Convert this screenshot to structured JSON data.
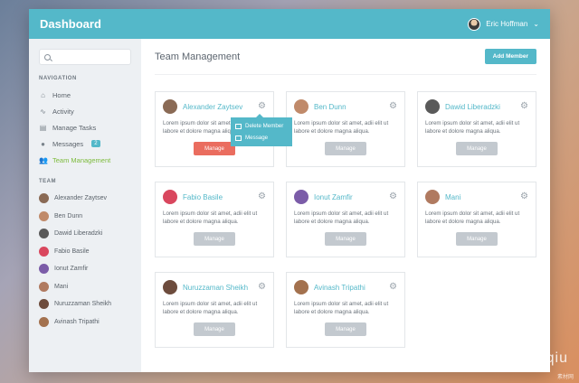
{
  "header": {
    "title": "Dashboard",
    "user_name": "Eric Hoffman"
  },
  "sidebar": {
    "search_placeholder": "",
    "navigation_heading": "NAVIGATION",
    "nav": [
      {
        "label": "Home",
        "icon": "home-icon"
      },
      {
        "label": "Activity",
        "icon": "activity-icon"
      },
      {
        "label": "Manage Tasks",
        "icon": "tasks-icon"
      },
      {
        "label": "Messages",
        "icon": "messages-icon",
        "badge": "2"
      },
      {
        "label": "Team Management",
        "icon": "team-icon",
        "active": true
      }
    ],
    "team_heading": "TEAM",
    "team": [
      "Alexander Zaytsev",
      "Ben Dunn",
      "Dawid Liberadzki",
      "Fabio Basile",
      "Ionut Zamfir",
      "Mani",
      "Nuruzzaman Sheikh",
      "Avinash Tripathi"
    ]
  },
  "main": {
    "title": "Team Management",
    "add_button": "Add Member",
    "cards": [
      {
        "name": "Alexander Zaytsev",
        "text": "Lorem ipsum dolor sit amet, adii elit ut labore et dolore magna aliqua.",
        "button": "Manage"
      },
      {
        "name": "Ben Dunn",
        "text": "Lorem ipsum dolor sit amet, adii elit ut labore et dolore magna aliqua.",
        "button": "Manage"
      },
      {
        "name": "Dawid Liberadzki",
        "text": "Lorem ipsum dolor sit amet, adii elit ut labore et dolore magna aliqua.",
        "button": "Manage"
      },
      {
        "name": "Fabio Basile",
        "text": "Lorem ipsum dolor sit amet, adii elit ut labore et dolore magna aliqua.",
        "button": "Manage"
      },
      {
        "name": "Ionut Zamfir",
        "text": "Lorem ipsum dolor sit amet, adii elit ut labore et dolore magna aliqua.",
        "button": "Manage"
      },
      {
        "name": "Mani",
        "text": "Lorem ipsum dolor sit amet, adii elit ut labore et dolore magna aliqua.",
        "button": "Manage"
      },
      {
        "name": "Nuruzzaman Sheikh",
        "text": "Lorem ipsum dolor sit amet, adii elit ut labore et dolore magna aliqua.",
        "button": "Manage"
      },
      {
        "name": "Avinash Tripathi",
        "text": "Lorem ipsum dolor sit amet, adii elit ut labore et dolore magna aliqua.",
        "button": "Manage"
      }
    ],
    "dropdown": {
      "delete": "Delete Member",
      "message": "Message"
    }
  },
  "watermark": {
    "main": "微信号: iamyueshanqiu",
    "small": "素材网"
  },
  "colors": {
    "accent": "#54b8c9",
    "active_nav": "#7dbb3c",
    "danger": "#ea6d5f"
  }
}
